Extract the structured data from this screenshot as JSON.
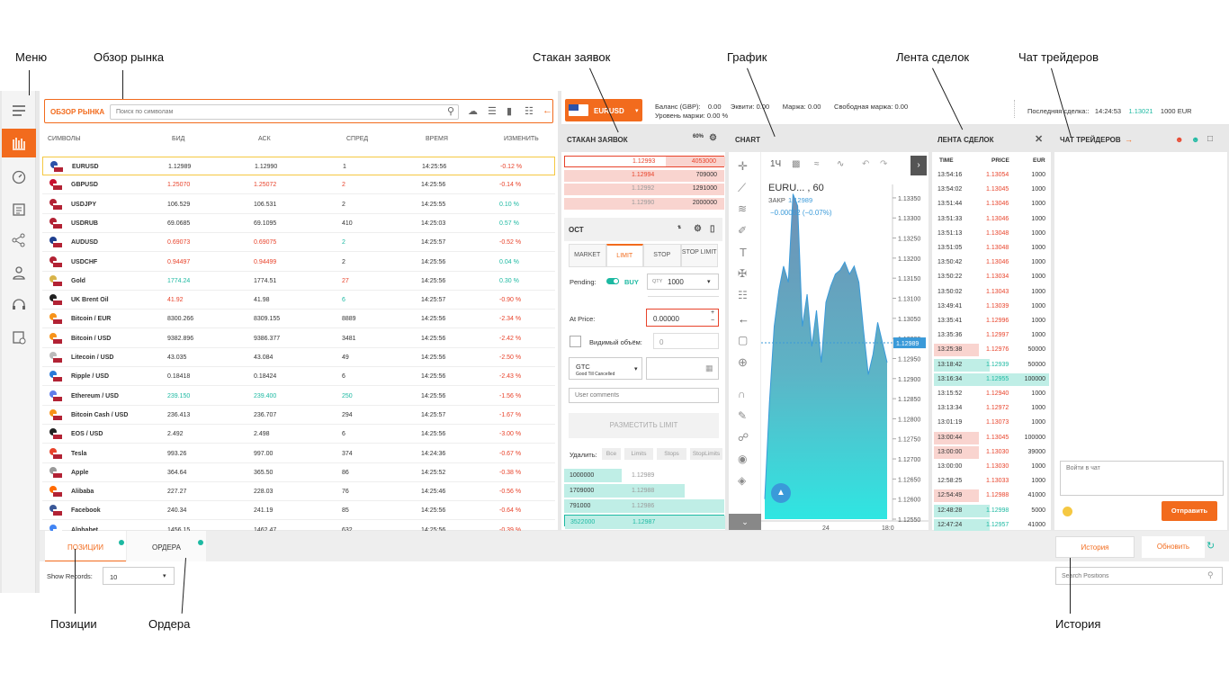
{
  "callouts": {
    "menu": "Меню",
    "market": "Обзор рынка",
    "orderbook": "Стакан заявок",
    "chart": "График",
    "trades": "Лента сделок",
    "chat": "Чат трейдеров",
    "positions": "Позиции",
    "orders": "Ордера",
    "history": "История"
  },
  "market": {
    "title": "ОБЗОР РЫНКА",
    "search_placeholder": "Поиск по символам",
    "columns": [
      "СИМВОЛЫ",
      "БИД",
      "АСК",
      "СПРЕД",
      "ВРЕМЯ",
      "ИЗМЕНИТЬ"
    ],
    "rows": [
      {
        "symbol": "EURUSD",
        "bid": "1.12989",
        "ask": "1.12990",
        "spread": "1",
        "time": "14:25:56",
        "change": "-0.12 %",
        "bc": "",
        "ac": "",
        "sc": "",
        "cc": "red",
        "flag": "eu"
      },
      {
        "symbol": "GBPUSD",
        "bid": "1.25070",
        "ask": "1.25072",
        "spread": "2",
        "time": "14:25:56",
        "change": "-0.14 %",
        "bc": "red",
        "ac": "red",
        "sc": "red",
        "cc": "red",
        "flag": "gb"
      },
      {
        "symbol": "USDJPY",
        "bid": "106.529",
        "ask": "106.531",
        "spread": "2",
        "time": "14:25:55",
        "change": "0.10 %",
        "bc": "",
        "ac": "",
        "sc": "",
        "cc": "green",
        "flag": "us"
      },
      {
        "symbol": "USDRUB",
        "bid": "69.0685",
        "ask": "69.1095",
        "spread": "410",
        "time": "14:25:03",
        "change": "0.57 %",
        "bc": "",
        "ac": "",
        "sc": "",
        "cc": "green",
        "flag": "us"
      },
      {
        "symbol": "AUDUSD",
        "bid": "0.69073",
        "ask": "0.69075",
        "spread": "2",
        "time": "14:25:57",
        "change": "-0.52 %",
        "bc": "red",
        "ac": "red",
        "sc": "green",
        "cc": "red",
        "flag": "au"
      },
      {
        "symbol": "USDCHF",
        "bid": "0.94497",
        "ask": "0.94499",
        "spread": "2",
        "time": "14:25:56",
        "change": "0.04 %",
        "bc": "red",
        "ac": "red",
        "sc": "",
        "cc": "green",
        "flag": "us"
      },
      {
        "symbol": "Gold",
        "bid": "1774.24",
        "ask": "1774.51",
        "spread": "27",
        "time": "14:25:56",
        "change": "0.30 %",
        "bc": "green",
        "ac": "",
        "sc": "red",
        "cc": "green",
        "flag": "gold"
      },
      {
        "symbol": "UK Brent Oil",
        "bid": "41.92",
        "ask": "41.98",
        "spread": "6",
        "time": "14:25:57",
        "change": "-0.90 %",
        "bc": "red",
        "ac": "",
        "sc": "green",
        "cc": "red",
        "flag": "oil"
      },
      {
        "symbol": "Bitcoin / EUR",
        "bid": "8300.266",
        "ask": "8309.155",
        "spread": "8889",
        "time": "14:25:56",
        "change": "-2.34 %",
        "bc": "",
        "ac": "",
        "sc": "",
        "cc": "red",
        "flag": "btc"
      },
      {
        "symbol": "Bitcoin / USD",
        "bid": "9382.896",
        "ask": "9386.377",
        "spread": "3481",
        "time": "14:25:56",
        "change": "-2.42 %",
        "bc": "",
        "ac": "",
        "sc": "",
        "cc": "red",
        "flag": "btc"
      },
      {
        "symbol": "Litecoin / USD",
        "bid": "43.035",
        "ask": "43.084",
        "spread": "49",
        "time": "14:25:56",
        "change": "-2.50 %",
        "bc": "",
        "ac": "",
        "sc": "",
        "cc": "red",
        "flag": "ltc"
      },
      {
        "symbol": "Ripple / USD",
        "bid": "0.18418",
        "ask": "0.18424",
        "spread": "6",
        "time": "14:25:56",
        "change": "-2.43 %",
        "bc": "",
        "ac": "",
        "sc": "",
        "cc": "red",
        "flag": "xrp"
      },
      {
        "symbol": "Ethereum / USD",
        "bid": "239.150",
        "ask": "239.400",
        "spread": "250",
        "time": "14:25:56",
        "change": "-1.56 %",
        "bc": "green",
        "ac": "green",
        "sc": "green",
        "cc": "red",
        "flag": "eth"
      },
      {
        "symbol": "Bitcoin Cash / USD",
        "bid": "236.413",
        "ask": "236.707",
        "spread": "294",
        "time": "14:25:57",
        "change": "-1.67 %",
        "bc": "",
        "ac": "",
        "sc": "",
        "cc": "red",
        "flag": "btc"
      },
      {
        "symbol": "EOS / USD",
        "bid": "2.492",
        "ask": "2.498",
        "spread": "6",
        "time": "14:25:56",
        "change": "-3.00 %",
        "bc": "",
        "ac": "",
        "sc": "",
        "cc": "red",
        "flag": "eos"
      },
      {
        "symbol": "Tesla",
        "bid": "993.26",
        "ask": "997.00",
        "spread": "374",
        "time": "14:24:36",
        "change": "-0.67 %",
        "bc": "",
        "ac": "",
        "sc": "",
        "cc": "red",
        "flag": "tsla"
      },
      {
        "symbol": "Apple",
        "bid": "364.64",
        "ask": "365.50",
        "spread": "86",
        "time": "14:25:52",
        "change": "-0.38 %",
        "bc": "",
        "ac": "",
        "sc": "",
        "cc": "red",
        "flag": "aapl"
      },
      {
        "symbol": "Alibaba",
        "bid": "227.27",
        "ask": "228.03",
        "spread": "76",
        "time": "14:25:46",
        "change": "-0.56 %",
        "bc": "",
        "ac": "",
        "sc": "",
        "cc": "red",
        "flag": "baba"
      },
      {
        "symbol": "Facebook",
        "bid": "240.34",
        "ask": "241.19",
        "spread": "85",
        "time": "14:25:56",
        "change": "-0.64 %",
        "bc": "",
        "ac": "",
        "sc": "",
        "cc": "red",
        "flag": "fb"
      },
      {
        "symbol": "Alphabet",
        "bid": "1456.15",
        "ask": "1462.47",
        "spread": "632",
        "time": "14:25:56",
        "change": "-0.39 %",
        "bc": "",
        "ac": "",
        "sc": "",
        "cc": "red",
        "flag": "goog"
      }
    ]
  },
  "topbar": {
    "symbol": "EURUSD",
    "balance_label": "Баланс (GBP):",
    "balance": "0.00",
    "equity_label": "Эквити:",
    "equity": "0.00",
    "margin_label": "Маржа:",
    "margin": "0.00",
    "free_margin_label": "Свободная маржа:",
    "free_margin": "0.00",
    "margin_level_label": "Уровень маржи:",
    "margin_level": "0.00 %",
    "last_trade_label": "Последняя сделка::",
    "last_trade_time": "14:24:53",
    "last_trade_price": "1.13021",
    "last_trade_amount": "1000 EUR"
  },
  "orderbook": {
    "title": "СТАКАН ЗАЯВОК",
    "asks": [
      {
        "price": "1.12993",
        "vol": "4053000"
      },
      {
        "price": "1.12994",
        "vol": "709000"
      },
      {
        "price": "1.12992",
        "vol": "1291000"
      },
      {
        "price": "1.12990",
        "vol": "2000000"
      }
    ],
    "bids": [
      {
        "price": "1.12989",
        "vol": "1000000"
      },
      {
        "price": "1.12988",
        "vol": "1709000"
      },
      {
        "price": "1.12986",
        "vol": "791000"
      },
      {
        "price": "1.12987",
        "vol": "3522000"
      }
    ]
  },
  "ticket": {
    "title": "ОСТ",
    "tabs": [
      "MARKET",
      "LIMIT",
      "STOP",
      "STOP LIMIT"
    ],
    "pending_label": "Pending:",
    "buy": "BUY",
    "qty_label": "QTY",
    "qty": "1000",
    "price_label": "At Price:",
    "price": "0.00000",
    "visible_label": "Видимый объём:",
    "visible_value": "0",
    "tif": "GTC",
    "tif_sub": "Good Till Cancelled",
    "comments_placeholder": "User comments",
    "submit": "РАЗМЕСТИТЬ LIMIT",
    "delete_label": "Удалить:",
    "delete_btns": [
      "Все",
      "Limits",
      "Stops",
      "StopLimits"
    ],
    "book_icon_label": "60%"
  },
  "chart": {
    "title": "CHART",
    "timeframe": "1Ч",
    "symbol": "EURU... , 60",
    "close_label": "ЗАКР",
    "close_value": "1.12989",
    "change": "−0.00082 (−0.07%)",
    "current_price": "1.12989",
    "yticks": [
      "1.13350",
      "1.13300",
      "1.13250",
      "1.13200",
      "1.13150",
      "1.13100",
      "1.13050",
      "1.13000",
      "1.12950",
      "1.12900",
      "1.12850",
      "1.12800",
      "1.12750",
      "1.12700",
      "1.12650",
      "1.12600",
      "1.12550"
    ],
    "xticks": [
      "24",
      "18:0"
    ]
  },
  "chart_data": {
    "type": "area",
    "title": "EURU... , 60",
    "xlabel": "",
    "ylabel": "",
    "x_ticks": [
      "24",
      "18:0"
    ],
    "ylim": [
      1.1255,
      1.1337
    ],
    "series": [
      {
        "name": "",
        "values": [
          1.126,
          1.1284,
          1.1303,
          1.1312,
          1.1318,
          1.1314,
          1.1336,
          1.1333,
          1.1303,
          1.1311,
          1.1298,
          1.1307,
          1.1294,
          1.1309,
          1.1313,
          1.1316,
          1.1317,
          1.1319,
          1.1316,
          1.1318,
          1.1314,
          1.1302,
          1.1291,
          1.1296,
          1.1304,
          1.1299,
          1.1294
        ]
      }
    ]
  },
  "trades": {
    "title": "ЛЕНТА СДЕЛОК",
    "columns": [
      "TIME",
      "PRICE",
      "EUR"
    ],
    "rows": [
      {
        "t": "13:54:16",
        "p": "1.13054",
        "v": "1000",
        "hl": ""
      },
      {
        "t": "13:54:02",
        "p": "1.13045",
        "v": "1000",
        "hl": ""
      },
      {
        "t": "13:51:44",
        "p": "1.13046",
        "v": "1000",
        "hl": ""
      },
      {
        "t": "13:51:33",
        "p": "1.13046",
        "v": "1000",
        "hl": ""
      },
      {
        "t": "13:51:13",
        "p": "1.13048",
        "v": "1000",
        "hl": ""
      },
      {
        "t": "13:51:05",
        "p": "1.13048",
        "v": "1000",
        "hl": ""
      },
      {
        "t": "13:50:42",
        "p": "1.13046",
        "v": "1000",
        "hl": ""
      },
      {
        "t": "13:50:22",
        "p": "1.13034",
        "v": "1000",
        "hl": ""
      },
      {
        "t": "13:50:02",
        "p": "1.13043",
        "v": "1000",
        "hl": ""
      },
      {
        "t": "13:49:41",
        "p": "1.13039",
        "v": "1000",
        "hl": ""
      },
      {
        "t": "13:35:41",
        "p": "1.12996",
        "v": "1000",
        "hl": ""
      },
      {
        "t": "13:35:36",
        "p": "1.12997",
        "v": "1000",
        "hl": ""
      },
      {
        "t": "13:25:38",
        "p": "1.12976",
        "v": "50000",
        "hl": "red"
      },
      {
        "t": "13:18:42",
        "p": "1.12939",
        "v": "50000",
        "hl": "green"
      },
      {
        "t": "13:16:34",
        "p": "1.12955",
        "v": "100000",
        "hl": "green"
      },
      {
        "t": "13:15:52",
        "p": "1.12940",
        "v": "1000",
        "hl": ""
      },
      {
        "t": "13:13:34",
        "p": "1.12972",
        "v": "1000",
        "hl": ""
      },
      {
        "t": "13:01:19",
        "p": "1.13073",
        "v": "1000",
        "hl": ""
      },
      {
        "t": "13:00:44",
        "p": "1.13045",
        "v": "100000",
        "hl": "red"
      },
      {
        "t": "13:00:00",
        "p": "1.13030",
        "v": "39000",
        "hl": "red"
      },
      {
        "t": "13:00:00",
        "p": "1.13030",
        "v": "1000",
        "hl": ""
      },
      {
        "t": "12:58:25",
        "p": "1.13033",
        "v": "1000",
        "hl": ""
      },
      {
        "t": "12:54:49",
        "p": "1.12988",
        "v": "41000",
        "hl": "red"
      },
      {
        "t": "12:48:28",
        "p": "1.12998",
        "v": "5000",
        "hl": "green"
      },
      {
        "t": "12:47:24",
        "p": "1.12957",
        "v": "41000",
        "hl": "green"
      }
    ]
  },
  "chat": {
    "title": "ЧАТ ТРЕЙДЕРОВ",
    "input_placeholder": "Войти в чат",
    "send": "Отправить"
  },
  "bottom": {
    "positions_tab": "ПОЗИЦИИ",
    "orders_tab": "ОРДЕРА",
    "history_btn": "История",
    "refresh_btn": "Обновить",
    "show_records_label": "Show Records:",
    "records": "10",
    "search_placeholder": "Search Positions"
  }
}
